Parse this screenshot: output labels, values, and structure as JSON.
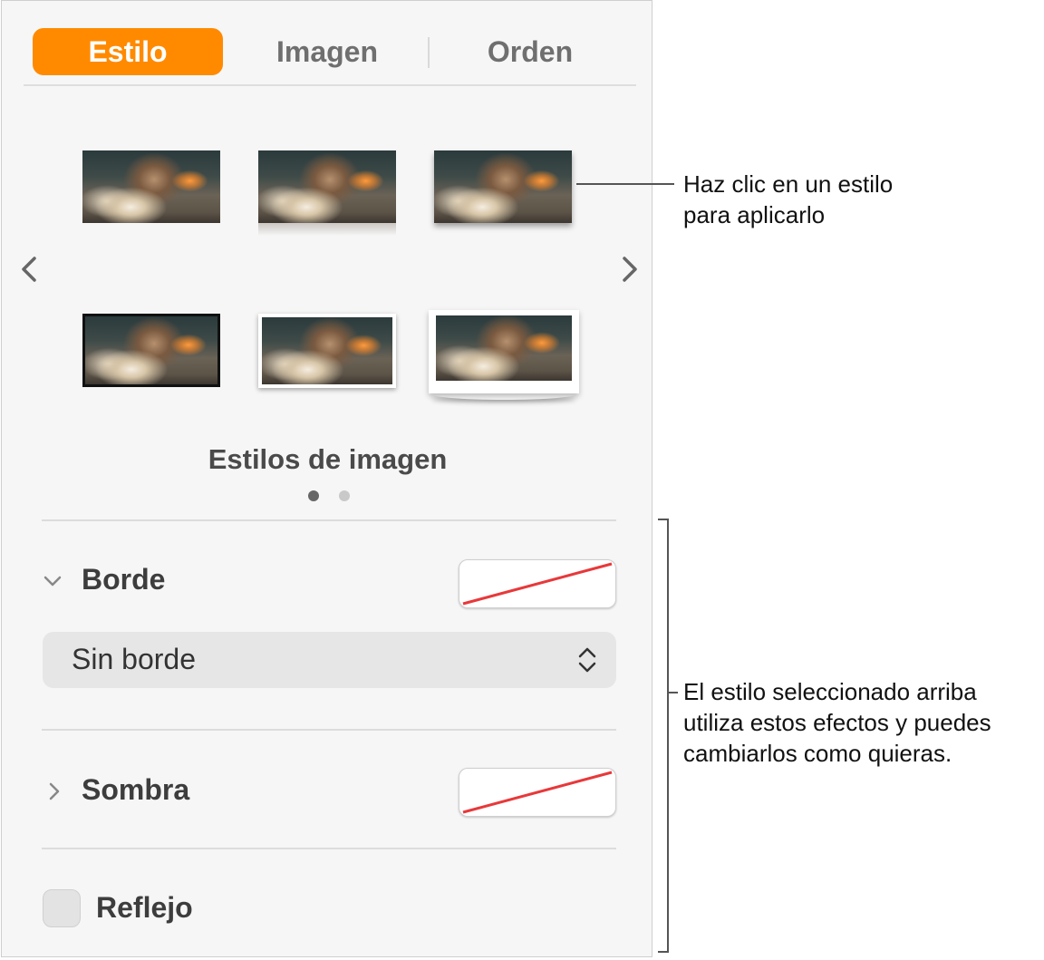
{
  "tabs": [
    {
      "label": "Estilo",
      "active": true
    },
    {
      "label": "Imagen",
      "active": false
    },
    {
      "label": "Orden",
      "active": false
    }
  ],
  "styles_section": {
    "title": "Estilos de imagen",
    "page_dots": 2,
    "current_page": 1,
    "thumbnail_icon": "photo-thumbnail",
    "prev_icon": "chevron-left-icon",
    "next_icon": "chevron-right-icon"
  },
  "border": {
    "label": "Borde",
    "expanded": true,
    "select_value": "Sin borde",
    "swatch": "none"
  },
  "shadow": {
    "label": "Sombra",
    "expanded": false,
    "swatch": "none"
  },
  "reflection": {
    "label": "Reflejo",
    "checked": false
  },
  "callouts": {
    "top": [
      "Haz clic en un estilo",
      "para aplicarlo"
    ],
    "bottom": [
      "El estilo seleccionado arriba",
      "utiliza estos efectos y puedes",
      "cambiarlos como quieras."
    ]
  },
  "colors": {
    "accent": "#ff8a00",
    "panel_bg": "#f6f6f6",
    "no_color_slash": "#e8383a"
  }
}
